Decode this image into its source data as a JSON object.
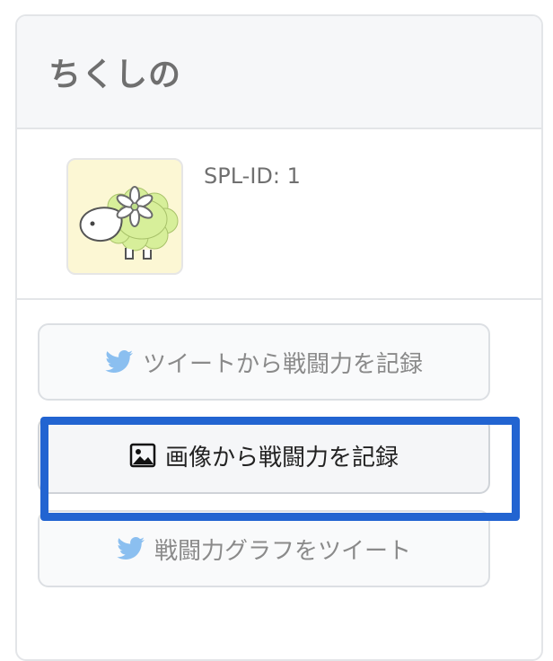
{
  "card": {
    "title": "ちくしの"
  },
  "profile": {
    "spl_id": "SPL-ID: 1"
  },
  "buttons": [
    {
      "label": "ツイートから戦闘力を記録",
      "icon": "twitter-icon"
    },
    {
      "label": "画像から戦闘力を記録",
      "icon": "image-icon"
    },
    {
      "label": "戦闘力グラフをツイート",
      "icon": "twitter-icon"
    }
  ],
  "colors": {
    "highlight": "#2264d1",
    "twitter": "#8bbff0",
    "avatar_bg": "#fcf7d4"
  }
}
